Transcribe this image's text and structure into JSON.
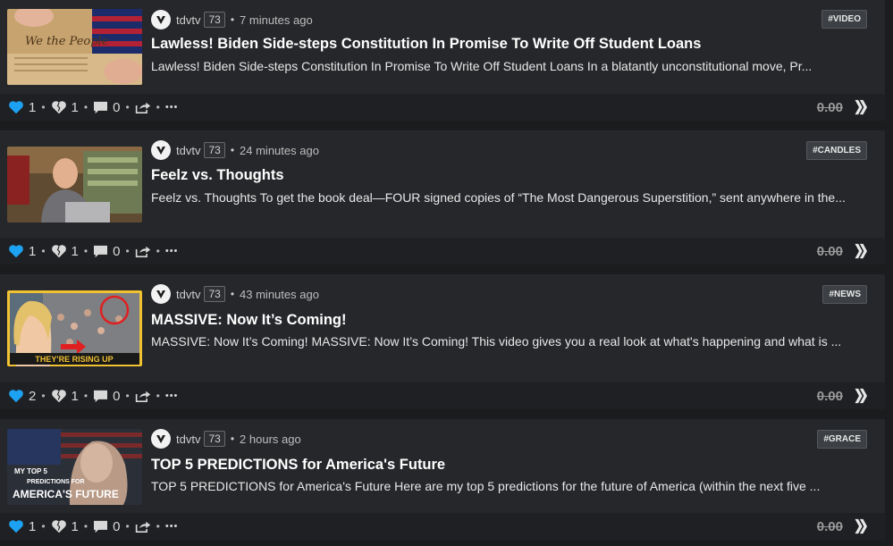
{
  "colors": {
    "accent_heart": "#1da1f2",
    "card_bg": "#25272a",
    "bar_bg": "#1f2023"
  },
  "icons": {
    "upvote": "heart-icon",
    "downvote": "broken-heart-icon",
    "comment": "comment-icon",
    "reblog": "share-icon",
    "more": "more-icon",
    "currency": "hive-logo-icon"
  },
  "posts": [
    {
      "author": "tdvtv",
      "reputation": "73",
      "separator": "•",
      "time": "7 minutes ago",
      "tag": "#VIDEO",
      "title": "Lawless! Biden Side-steps Constitution In Promise To Write Off Student Loans",
      "snippet": "Lawless! Biden Side-steps Constitution In Promise To Write Off Student Loans In a blatantly unconstitutional move, Pr...",
      "upvotes": "1",
      "downvotes": "1",
      "comments": "0",
      "payout": "0.00"
    },
    {
      "author": "tdvtv",
      "reputation": "73",
      "separator": "•",
      "time": "24 minutes ago",
      "tag": "#CANDLES",
      "title": "Feelz vs. Thoughts",
      "snippet": "Feelz vs. Thoughts To get the book deal—FOUR signed copies of “The Most Dangerous Superstition,” sent anywhere in the...",
      "upvotes": "1",
      "downvotes": "1",
      "comments": "0",
      "payout": "0.00"
    },
    {
      "author": "tdvtv",
      "reputation": "73",
      "separator": "•",
      "time": "43 minutes ago",
      "tag": "#NEWS",
      "title": "MASSIVE: Now It’s Coming!",
      "snippet": "MASSIVE: Now It’s Coming! MASSIVE: Now It’s Coming! This video gives you a real look at what's happening and what is ...",
      "thumb_text": "THEY'RE RISING UP",
      "upvotes": "2",
      "downvotes": "1",
      "comments": "0",
      "payout": "0.00"
    },
    {
      "author": "tdvtv",
      "reputation": "73",
      "separator": "•",
      "time": "2 hours ago",
      "tag": "#GRACE",
      "title": "TOP 5 PREDICTIONS for America's Future",
      "snippet": "TOP 5 PREDICTIONS for America's Future Here are my top 5 predictions for the future of America (within the next five ...",
      "thumb_text_1": "MY TOP 5",
      "thumb_text_2": "PREDICTIONS FOR",
      "thumb_text_3": "AMERICA'S FUTURE",
      "upvotes": "1",
      "downvotes": "1",
      "comments": "0",
      "payout": "0.00"
    }
  ],
  "bar_separator": "•",
  "more_label": "•••"
}
